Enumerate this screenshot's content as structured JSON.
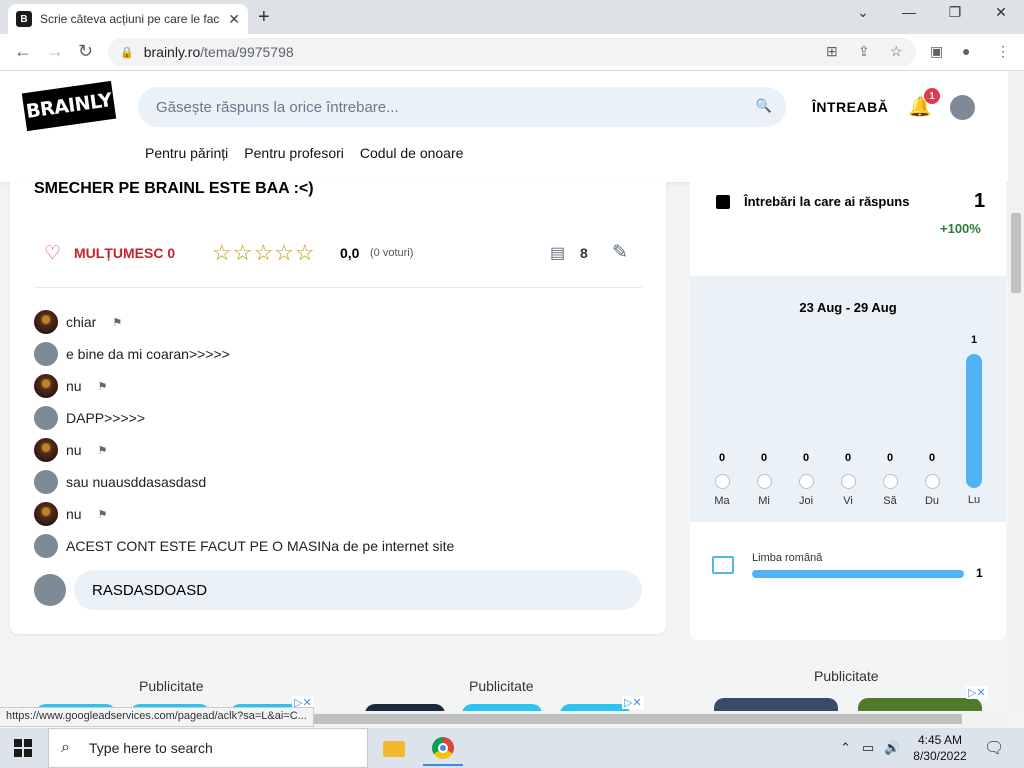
{
  "browser": {
    "tab_title": "Scrie câteva acțiuni pe care le fac",
    "tab_close": "✕",
    "new_tab": "+",
    "url_domain": "brainly.ro",
    "url_path": "/tema/9975798",
    "status_url": "https://www.googleadservices.com/pagead/aclk?sa=L&ai=C..."
  },
  "site": {
    "logo_text": "BRAINLY",
    "search_placeholder": "Găsește răspuns la orice întrebare...",
    "ask_label": "ÎNTREABĂ",
    "notification_count": "1",
    "subnav": [
      "Pentru părinți",
      "Pentru profesori",
      "Codul de onoare"
    ]
  },
  "question": {
    "title": "SMECHER PE BRAINL ESTE BAA :<)",
    "thanks_label": "MULȚUMESC 0",
    "stars": "☆☆☆☆☆",
    "rating": "0,0",
    "votes": "(0 voturi)",
    "comment_count": "8",
    "comments": [
      {
        "text": "chiar",
        "avatar": "photo",
        "flag": true
      },
      {
        "text": "e bine da mi coaran>>>>>",
        "avatar": "default",
        "flag": false
      },
      {
        "text": "nu",
        "avatar": "photo",
        "flag": true
      },
      {
        "text": "DAPP>>>>>",
        "avatar": "default",
        "flag": false
      },
      {
        "text": "nu",
        "avatar": "photo",
        "flag": true
      },
      {
        "text": "sau nuausddasasdasd",
        "avatar": "default",
        "flag": false
      },
      {
        "text": "nu",
        "avatar": "photo",
        "flag": true
      },
      {
        "text": "ACEST CONT ESTE FACUT PE O MASINa de pe internet site",
        "avatar": "default",
        "flag": false
      }
    ],
    "reply_value": "RASDASDOASD"
  },
  "stats": {
    "answered_label": "Întrebări la care ai răspuns",
    "answered_count": "1",
    "change": "+100%",
    "week_range": "23 Aug - 29 Aug",
    "days": [
      {
        "label": "Ma",
        "value": 0
      },
      {
        "label": "Mi",
        "value": 0
      },
      {
        "label": "Joi",
        "value": 0
      },
      {
        "label": "Vi",
        "value": 0
      },
      {
        "label": "Să",
        "value": 0
      },
      {
        "label": "Du",
        "value": 0
      },
      {
        "label": "Lu",
        "value": 1
      }
    ],
    "subject_name": "Limba română",
    "subject_count": "1",
    "accent_color": "#4fb3f6"
  },
  "ads": {
    "label": "Publicitate"
  },
  "taskbar": {
    "search_placeholder": "Type here to search",
    "time": "4:45 AM",
    "date": "8/30/2022"
  }
}
